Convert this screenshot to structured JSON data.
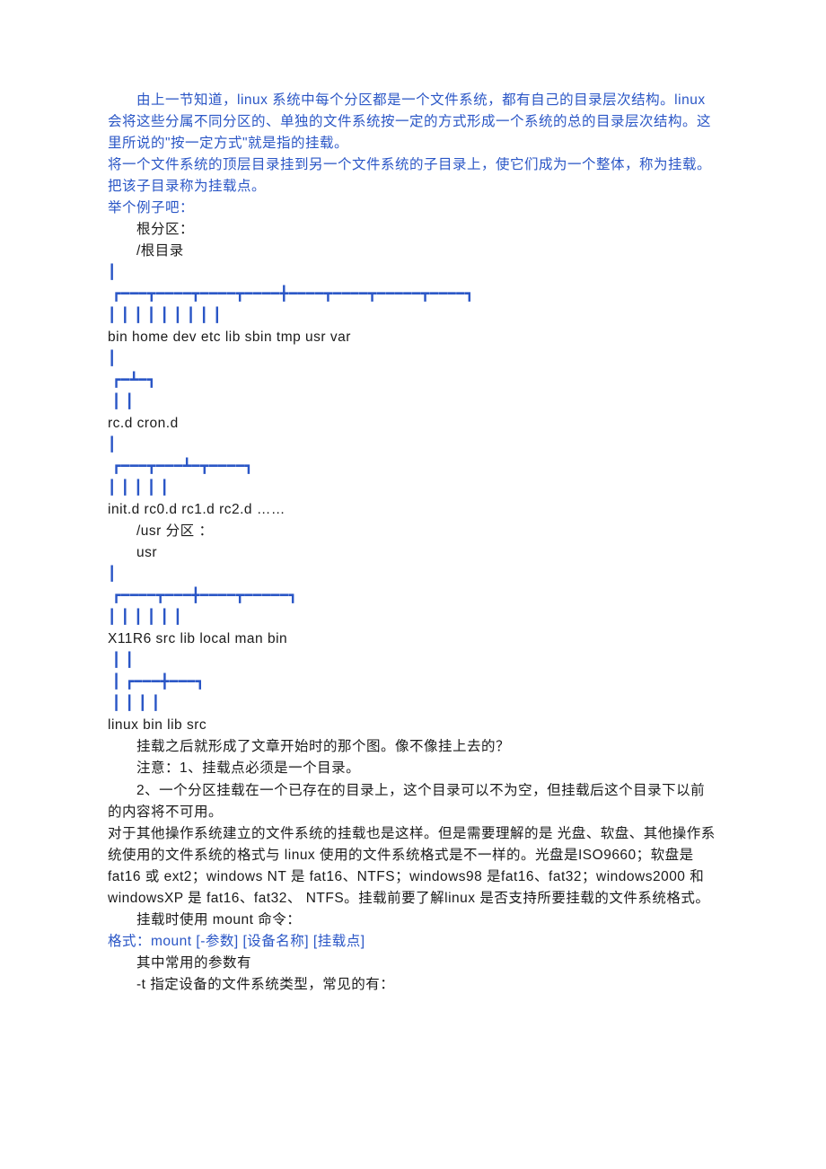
{
  "paragraphs": [
    {
      "indent": "　　",
      "pre": "由上一节知道，linux 系统中每个分区都是一个文件系统，都有自己的目录层次结构。linux 会将这些分属不同分区的、单独的文件系统按一定的方式形成一个系统的总的目录层次结构。这里所说的\"按一定方式\"就是指的挂载。",
      "blue": true
    },
    {
      "pre": "将一个文件系统的顶层目录挂到另一个文件系统的子目录上，使它们成为一个整体，称为挂载。把该子目录称为挂载点。",
      "blue": true
    },
    {
      "pre": "举个例子吧：",
      "blue": true
    },
    {
      "indent": "　　",
      "pre": "根分区：",
      "blue": false
    },
    {
      "indent": "　　",
      "pre": "/根目录",
      "blue": false
    },
    {
      "pre": "┃",
      "blue": true
    },
    {
      "pre": " ┏━━━┳━━━━┳━━━━┳━━━━╋━━━━┳━━━━┳━━━━━┳━━━━┓",
      "blue": true
    },
    {
      "pre": "┃ ┃ ┃ ┃ ┃ ┃ ┃ ┃ ┃",
      "blue": true
    },
    {
      "pre": "bin home dev etc lib sbin tmp usr var",
      "blue": false
    },
    {
      "pre": "┃",
      "blue": true
    },
    {
      "pre": " ┏━┻━┓",
      "blue": true
    },
    {
      "pre": " ┃ ┃",
      "blue": true
    },
    {
      "pre": "rc.d cron.d",
      "blue": false
    },
    {
      "pre": "┃",
      "blue": true
    },
    {
      "pre": " ┏━━━┳━━━┻━┳━━━━┓",
      "blue": true
    },
    {
      "pre": "┃ ┃ ┃ ┃ ┃",
      "blue": true
    },
    {
      "pre": "init.d rc0.d rc1.d rc2.d ……",
      "blue": false
    },
    {
      "indent": "　　",
      "pre": "/usr 分区 ：",
      "blue": false
    },
    {
      "indent": "　　",
      "pre": "usr",
      "blue": false
    },
    {
      "pre": "┃",
      "blue": true
    },
    {
      "pre": " ┏━━━━┳━━━╋━━━━┳━━━━━┓",
      "blue": true
    },
    {
      "pre": "┃ ┃ ┃ ┃ ┃ ┃",
      "blue": true
    },
    {
      "pre": "X11R6 src lib local man bin",
      "blue": false
    },
    {
      "pre": " ┃ ┃",
      "blue": true
    },
    {
      "pre": " ┃ ┏━━━╋━━━┓",
      "blue": true
    },
    {
      "pre": " ┃ ┃ ┃ ┃",
      "blue": true
    },
    {
      "pre": "linux bin lib src",
      "blue": false
    },
    {
      "indent": "　　",
      "pre": "挂载之后就形成了文章开始时的那个图。像不像挂上去的？",
      "blue": false
    },
    {
      "indent": "　　",
      "pre": "注意：1、挂载点必须是一个目录。",
      "blue": false
    },
    {
      "indent": "　　",
      "pre": "2、一个分区挂载在一个已存在的目录上，这个目录可以不为空，但挂载后这个目录下以前的内容将不可用。",
      "blue": false
    },
    {
      "pre": "对于其他操作系统建立的文件系统的挂载也是这样。但是需要理解的是 光盘、软盘、其他操作系统使用的文件系统的格式与 linux 使用的文件系统格式是不一样的。光盘是ISO9660；软盘是 fat16 或 ext2；windows NT 是 fat16、NTFS；windows98 是fat16、fat32；windows2000 和 windowsXP 是 fat16、fat32、 NTFS。挂载前要了解linux 是否支持所要挂载的文件系统格式。",
      "blue": false
    },
    {
      "indent": "　　",
      "pre": "挂载时使用 mount 命令：",
      "blue": false
    },
    {
      "pre": "格式：mount [-参数] [设备名称] [挂载点]",
      "blue": true
    },
    {
      "indent": "　　",
      "pre": "其中常用的参数有",
      "blue": false
    },
    {
      "indent": "　　",
      "pre": "-t 指定设备的文件系统类型，常见的有：",
      "blue": false
    }
  ]
}
